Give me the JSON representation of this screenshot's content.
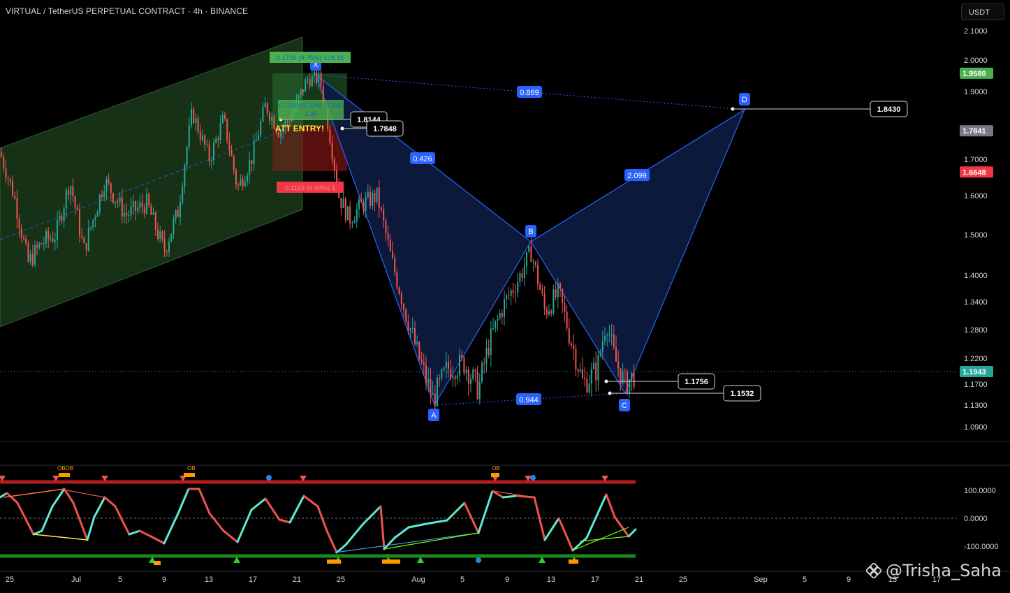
{
  "header": {
    "title": "VIRTUAL / TetherUS PERPETUAL CONTRACT · 4h · BINANCE"
  },
  "currency_button": {
    "label": "USDT"
  },
  "price_axis": {
    "ticks": [
      {
        "label": "2.1000",
        "value": 2.1
      },
      {
        "label": "2.0000",
        "value": 2.0
      },
      {
        "label": "1.9000",
        "value": 1.9
      },
      {
        "label": "1.7000",
        "value": 1.7
      },
      {
        "label": "1.6000",
        "value": 1.6
      },
      {
        "label": "1.5000",
        "value": 1.5
      },
      {
        "label": "1.4000",
        "value": 1.4
      },
      {
        "label": "1.3400",
        "value": 1.34
      },
      {
        "label": "1.2800",
        "value": 1.28
      },
      {
        "label": "1.2200",
        "value": 1.22
      },
      {
        "label": "1.1700",
        "value": 1.17
      },
      {
        "label": "1.1300",
        "value": 1.13
      },
      {
        "label": "1.0900",
        "value": 1.09
      }
    ],
    "badges": [
      {
        "label": "1.9580",
        "value": 1.958,
        "color": "#4caf50"
      },
      {
        "label": "1.7841",
        "value": 1.7841,
        "color": "#787b86"
      },
      {
        "label": "1.6648",
        "value": 1.6648,
        "color": "#f23645"
      },
      {
        "label": "1.1943",
        "value": 1.1943,
        "color": "#26a69a"
      }
    ]
  },
  "oscillator_axis": {
    "ticks": [
      {
        "label": "100.0000",
        "value": 100
      },
      {
        "label": "0.0000",
        "value": 0
      },
      {
        "label": "-100.0000",
        "value": -100
      }
    ]
  },
  "time_axis": {
    "labels": [
      "25",
      "Jul",
      "5",
      "9",
      "13",
      "17",
      "21",
      "25",
      "Aug",
      "5",
      "9",
      "13",
      "17",
      "21",
      "25",
      "Sep",
      "5",
      "9",
      "13",
      "17"
    ]
  },
  "pattern": {
    "points": [
      {
        "name": "X",
        "price": 1.96
      },
      {
        "name": "A",
        "price": 1.13
      },
      {
        "name": "B",
        "price": 1.48
      },
      {
        "name": "C",
        "price": 1.153
      },
      {
        "name": "D",
        "price": 1.843
      }
    ],
    "ratios": {
      "xb": "0.869",
      "ab": "0.426",
      "bd": "2.099",
      "ac": "0.944"
    }
  },
  "price_callouts": [
    "1.8144",
    "1.7848",
    "1.8430",
    "1.1756",
    "1.1532"
  ],
  "position_tool": {
    "target_label": "0.1739 (9.75%) 129.15",
    "target_inner_label": "0.1739 (9.75%) 17.645",
    "ratio_label": "1.45",
    "stop_label": "0.1193 (6.69%) 1",
    "entry_text": "ATT ENTRY!"
  },
  "oscillator_markers": {
    "ob_label": "OB",
    "obob_label": "OBOB"
  },
  "watermark": {
    "handle": "@Trisha_Saha"
  },
  "colors": {
    "bull": "#26a69a",
    "bear": "#ef5350",
    "pattern_line": "#2962ff",
    "pattern_fill": "#0d1a3d",
    "channel_fill": "#1b3a1b",
    "label_blue": "#2962ff"
  }
}
